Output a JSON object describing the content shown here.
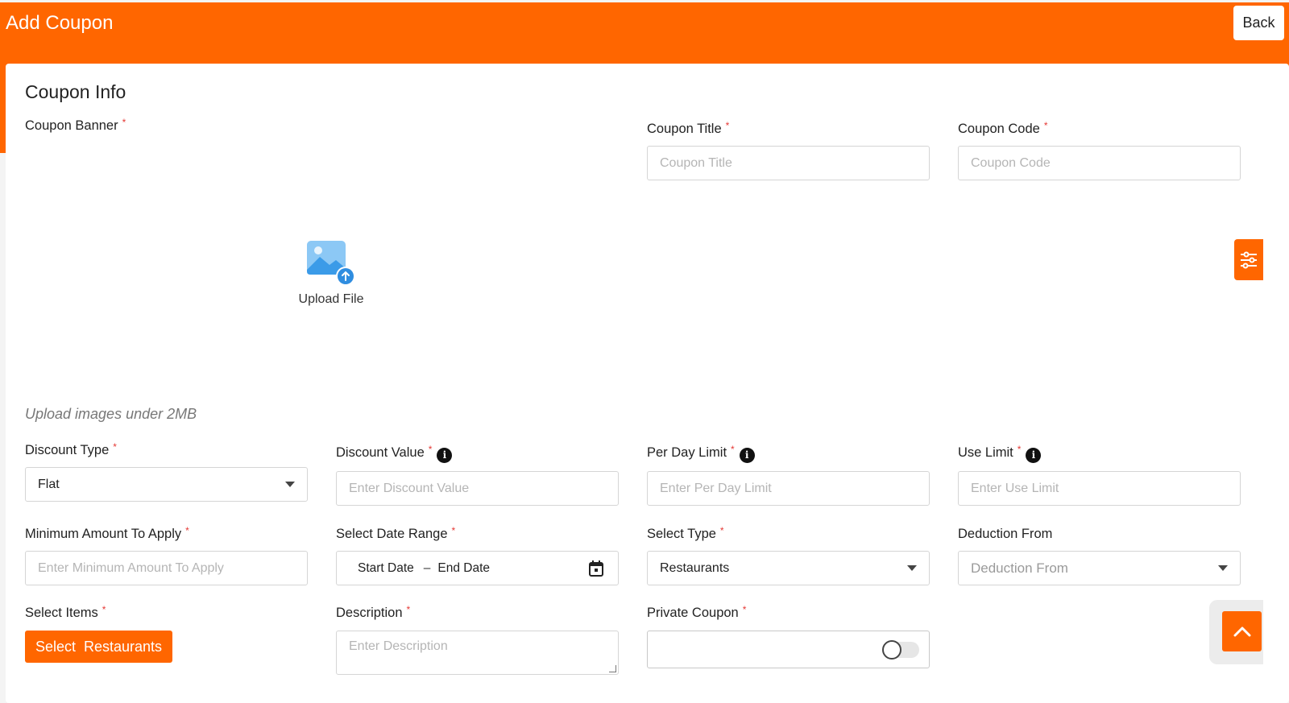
{
  "header": {
    "title": "Add Coupon",
    "back_label": "Back"
  },
  "section": {
    "title": "Coupon Info"
  },
  "banner": {
    "label": "Coupon Banner",
    "upload_label": "Upload File",
    "hint": "Upload images under 2MB"
  },
  "coupon_title": {
    "label": "Coupon Title",
    "placeholder": "Coupon Title"
  },
  "coupon_code": {
    "label": "Coupon Code",
    "placeholder": "Coupon Code"
  },
  "discount_type": {
    "label": "Discount Type",
    "value": "Flat"
  },
  "discount_value": {
    "label": "Discount Value",
    "placeholder": "Enter Discount Value"
  },
  "per_day_limit": {
    "label": "Per Day Limit",
    "placeholder": "Enter Per Day Limit"
  },
  "use_limit": {
    "label": "Use Limit",
    "placeholder": "Enter Use Limit"
  },
  "min_amount": {
    "label": "Minimum Amount To Apply",
    "placeholder": "Enter Minimum Amount To Apply"
  },
  "date_range": {
    "label": "Select Date Range",
    "start": "Start Date",
    "separator": "–",
    "end": "End Date"
  },
  "select_type": {
    "label": "Select Type",
    "value": "Restaurants"
  },
  "deduction_from": {
    "label": "Deduction From",
    "placeholder": "Deduction From"
  },
  "select_items": {
    "label": "Select Items",
    "button_label": "Select  Restaurants"
  },
  "description": {
    "label": "Description",
    "placeholder": "Enter Description"
  },
  "private_coupon": {
    "label": "Private Coupon",
    "enabled": false
  },
  "required_mark": "*",
  "info_glyph": "i",
  "colors": {
    "brand": "#ff6600",
    "required": "#e53935",
    "upload_icon": "#3b9be8"
  }
}
